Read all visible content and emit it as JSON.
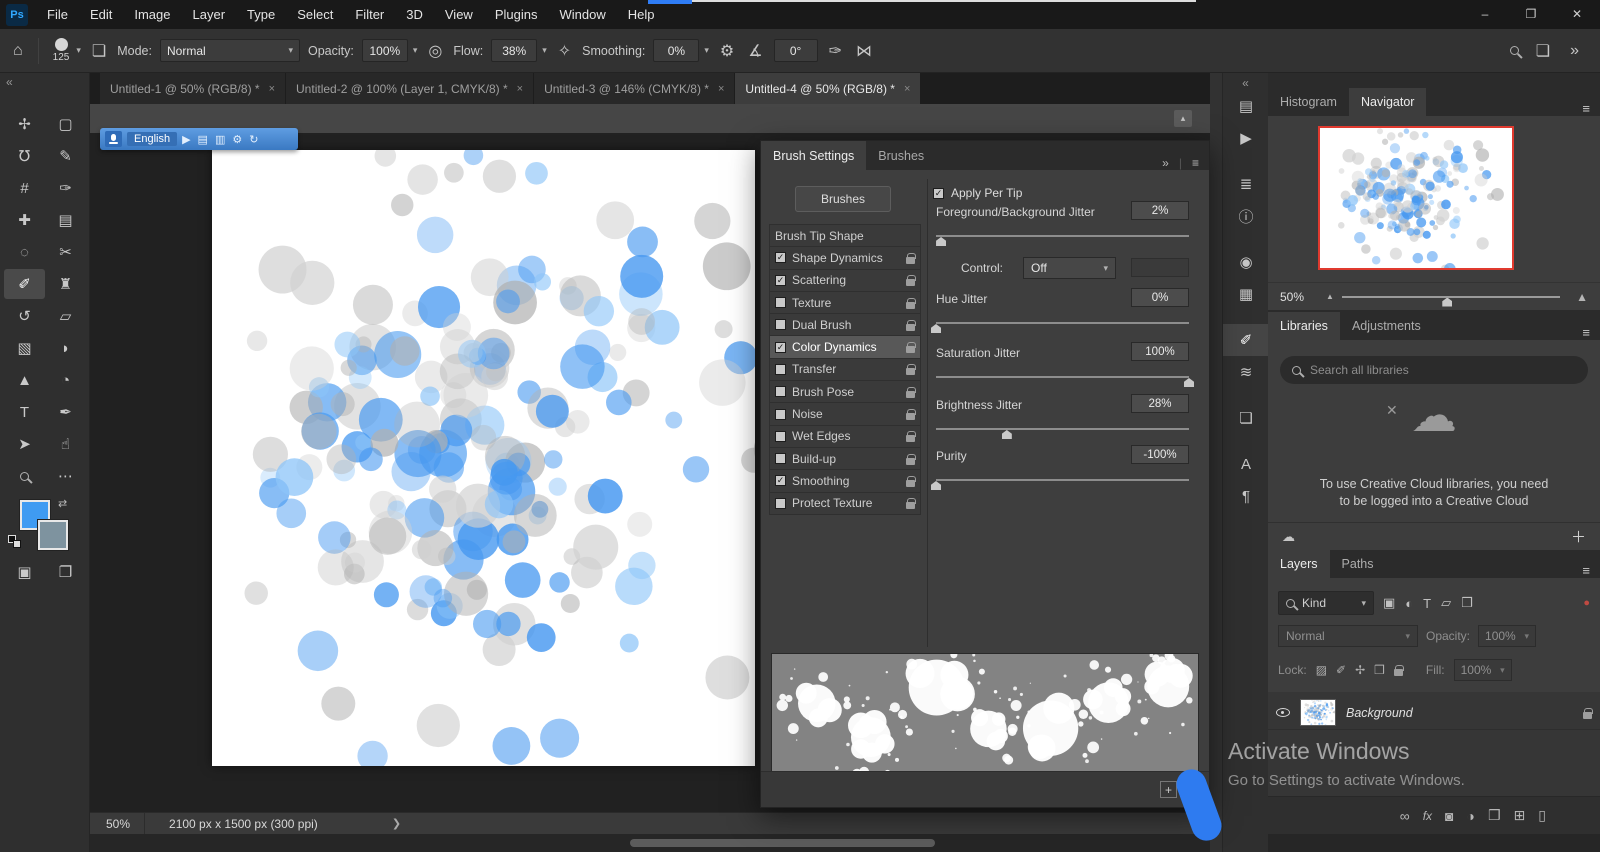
{
  "menu_bar": {
    "logo": "Ps",
    "items": [
      "File",
      "Edit",
      "Image",
      "Layer",
      "Type",
      "Select",
      "Filter",
      "3D",
      "View",
      "Plugins",
      "Window",
      "Help"
    ]
  },
  "window_controls": {
    "minimize": "–",
    "restore": "❐",
    "close": "✕"
  },
  "options_bar": {
    "brush_size": "125",
    "mode_label": "Mode:",
    "mode_value": "Normal",
    "opacity_label": "Opacity:",
    "opacity_value": "100%",
    "flow_label": "Flow:",
    "flow_value": "38%",
    "smoothing_label": "Smoothing:",
    "smoothing_value": "0%",
    "angle_value": "0°"
  },
  "document_tabs": [
    {
      "label": "Untitled-1 @ 50% (RGB/8) *",
      "active": false
    },
    {
      "label": "Untitled-2 @ 100% (Layer 1, CMYK/8) *",
      "active": false
    },
    {
      "label": "Untitled-3 @ 146% (CMYK/8) *",
      "active": false
    },
    {
      "label": "Untitled-4 @ 50% (RGB/8) *",
      "active": true
    }
  ],
  "language_bar": {
    "label": "English",
    "icons": [
      {
        "name": "play-icon",
        "glyph": "▶"
      },
      {
        "name": "document-icon",
        "glyph": "▤"
      },
      {
        "name": "microphone-small-icon",
        "glyph": "▥"
      },
      {
        "name": "settings-gear-icon",
        "glyph": "⚙"
      },
      {
        "name": "refresh-icon",
        "glyph": "↻"
      }
    ]
  },
  "toolbar": {
    "foreground_color": "#3f9bf2",
    "background_color": "#7e939f",
    "tools": [
      {
        "name": "move-tool",
        "glyph": "✢"
      },
      {
        "name": "marquee-tool",
        "glyph": "▢"
      },
      {
        "name": "lasso-tool",
        "glyph": "℧"
      },
      {
        "name": "quick-selection-tool",
        "glyph": "✎"
      },
      {
        "name": "crop-tool",
        "glyph": "#"
      },
      {
        "name": "eyedropper-tool",
        "glyph": "✑"
      },
      {
        "name": "healing-brush-tool",
        "glyph": "✚"
      },
      {
        "name": "patch-tool",
        "glyph": "▤"
      },
      {
        "name": "frame-tool",
        "glyph": "◌"
      },
      {
        "name": "slice-tool",
        "glyph": "✂"
      },
      {
        "name": "brush-tool",
        "glyph": "✐",
        "selected": true
      },
      {
        "name": "clone-stamp-tool",
        "glyph": "♜"
      },
      {
        "name": "history-brush-tool",
        "glyph": "↺"
      },
      {
        "name": "eraser-tool",
        "glyph": "▱"
      },
      {
        "name": "gradient-tool",
        "glyph": "▧"
      },
      {
        "name": "blur-tool",
        "glyph": "◗"
      },
      {
        "name": "shape-tool",
        "glyph": "▲"
      },
      {
        "name": "dodge-tool",
        "glyph": "◔"
      },
      {
        "name": "type-tool",
        "glyph": "T"
      },
      {
        "name": "pen-tool",
        "glyph": "✒"
      },
      {
        "name": "path-selection-tool",
        "glyph": "➤"
      },
      {
        "name": "hand-tool",
        "glyph": "☝"
      },
      {
        "name": "zoom-tool",
        "glyph": "MAG"
      },
      {
        "name": "edit-toolbar",
        "glyph": "⋯"
      }
    ],
    "extras": [
      {
        "name": "quick-mask-mode",
        "glyph": "▣"
      },
      {
        "name": "screen-mode",
        "glyph": "❐"
      }
    ]
  },
  "brush_panel": {
    "tab_active": "Brush Settings",
    "tab_inactive": "Brushes",
    "brushes_button": "Brushes",
    "apply_per_tip": "Apply Per Tip",
    "control_label": "Control:",
    "control_value": "Off",
    "list": [
      {
        "label": "Brush Tip Shape",
        "checkbox": false,
        "checked": false,
        "selected": false,
        "lock": false
      },
      {
        "label": "Shape Dynamics",
        "checkbox": true,
        "checked": true,
        "selected": false,
        "lock": true
      },
      {
        "label": "Scattering",
        "checkbox": true,
        "checked": true,
        "selected": false,
        "lock": true
      },
      {
        "label": "Texture",
        "checkbox": true,
        "checked": false,
        "selected": false,
        "lock": true
      },
      {
        "label": "Dual Brush",
        "checkbox": true,
        "checked": false,
        "selected": false,
        "lock": true
      },
      {
        "label": "Color Dynamics",
        "checkbox": true,
        "checked": true,
        "selected": true,
        "lock": true
      },
      {
        "label": "Transfer",
        "checkbox": true,
        "checked": false,
        "selected": false,
        "lock": true
      },
      {
        "label": "Brush Pose",
        "checkbox": true,
        "checked": false,
        "selected": false,
        "lock": true
      },
      {
        "label": "Noise",
        "checkbox": true,
        "checked": false,
        "selected": false,
        "lock": true
      },
      {
        "label": "Wet Edges",
        "checkbox": true,
        "checked": false,
        "selected": false,
        "lock": true
      },
      {
        "label": "Build-up",
        "checkbox": true,
        "checked": false,
        "selected": false,
        "lock": true
      },
      {
        "label": "Smoothing",
        "checkbox": true,
        "checked": true,
        "selected": false,
        "lock": true
      },
      {
        "label": "Protect Texture",
        "checkbox": true,
        "checked": false,
        "selected": false,
        "lock": true
      }
    ],
    "sliders": [
      {
        "label": "Foreground/Background Jitter",
        "value": "2%",
        "pos": 2
      },
      {
        "label": "Hue Jitter",
        "value": "0%",
        "pos": 0
      },
      {
        "label": "Saturation Jitter",
        "value": "100%",
        "pos": 100
      },
      {
        "label": "Brightness Jitter",
        "value": "28%",
        "pos": 28
      },
      {
        "label": "Purity",
        "value": "-100%",
        "pos": 0
      }
    ]
  },
  "right_dock": {
    "strip_icons": [
      {
        "name": "histogram-panel-icon",
        "glyph": "▤"
      },
      {
        "name": "actions-panel-icon",
        "glyph": "▶"
      },
      {
        "name": "adjustments-panel-icon",
        "glyph": "≣"
      },
      {
        "name": "info-panel-icon",
        "glyph": "ⓘ"
      },
      {
        "name": "color-panel-icon",
        "glyph": "◉"
      },
      {
        "name": "swatches-panel-icon",
        "glyph": "▦"
      },
      {
        "name": "brush-settings-panel-icon",
        "glyph": "✐",
        "active": true
      },
      {
        "name": "brushes-panel-icon",
        "glyph": "≋"
      },
      {
        "name": "clone-source-panel-icon",
        "glyph": "❏"
      },
      {
        "name": "character-panel-icon",
        "glyph": "A"
      },
      {
        "name": "paragraph-panel-icon",
        "glyph": "¶"
      }
    ],
    "navigator": {
      "tab_inactive": "Histogram",
      "tab_active": "Navigator",
      "zoom": "50%"
    },
    "libraries": {
      "tab_active": "Libraries",
      "tab_inactive": "Adjustments",
      "search_placeholder": "Search all libraries",
      "message_line1": "To use Creative Cloud libraries, you need",
      "message_line2": "to be logged into a Creative Cloud"
    },
    "layers": {
      "tab_active": "Layers",
      "tab_inactive": "Paths",
      "kind": "Kind",
      "filter_icons": [
        {
          "name": "filter-pixel-layers-icon",
          "glyph": "▣"
        },
        {
          "name": "filter-adjustment-layers-icon",
          "glyph": "◐"
        },
        {
          "name": "filter-type-layers-icon",
          "glyph": "T"
        },
        {
          "name": "filter-shape-layers-icon",
          "glyph": "▱"
        },
        {
          "name": "filter-smart-objects-icon",
          "glyph": "❒"
        }
      ],
      "filter_toggle_color": "#c04a42",
      "blend_mode": "Normal",
      "opacity_label": "Opacity:",
      "opacity_value": "100%",
      "lock_label": "Lock:",
      "lock_icons": [
        {
          "name": "lock-transparency-icon",
          "glyph": "▨"
        },
        {
          "name": "lock-paint-icon",
          "glyph": "✐"
        },
        {
          "name": "lock-move-icon",
          "glyph": "✢"
        },
        {
          "name": "lock-artboard-icon",
          "glyph": "❒"
        },
        {
          "name": "lock-all-icon",
          "glyph": "LOCK"
        }
      ],
      "fill_label": "Fill:",
      "fill_value": "100%",
      "layer_name": "Background",
      "bottom_icons": [
        {
          "name": "link-layers-icon",
          "glyph": "∞"
        },
        {
          "name": "layer-style-icon",
          "glyph": "fx"
        },
        {
          "name": "layer-mask-icon",
          "glyph": "◙"
        },
        {
          "name": "adjustment-layer-icon",
          "glyph": "◑"
        },
        {
          "name": "new-group-icon",
          "glyph": "❒"
        },
        {
          "name": "new-layer-icon",
          "glyph": "⊞"
        },
        {
          "name": "delete-layer-icon",
          "glyph": "▯"
        }
      ]
    }
  },
  "status_bar": {
    "zoom": "50%",
    "doc_info": "2100 px x 1500 px (300 ppi)"
  },
  "activate": {
    "line1": "Activate Windows",
    "line2": "Go to Settings to activate Windows."
  }
}
